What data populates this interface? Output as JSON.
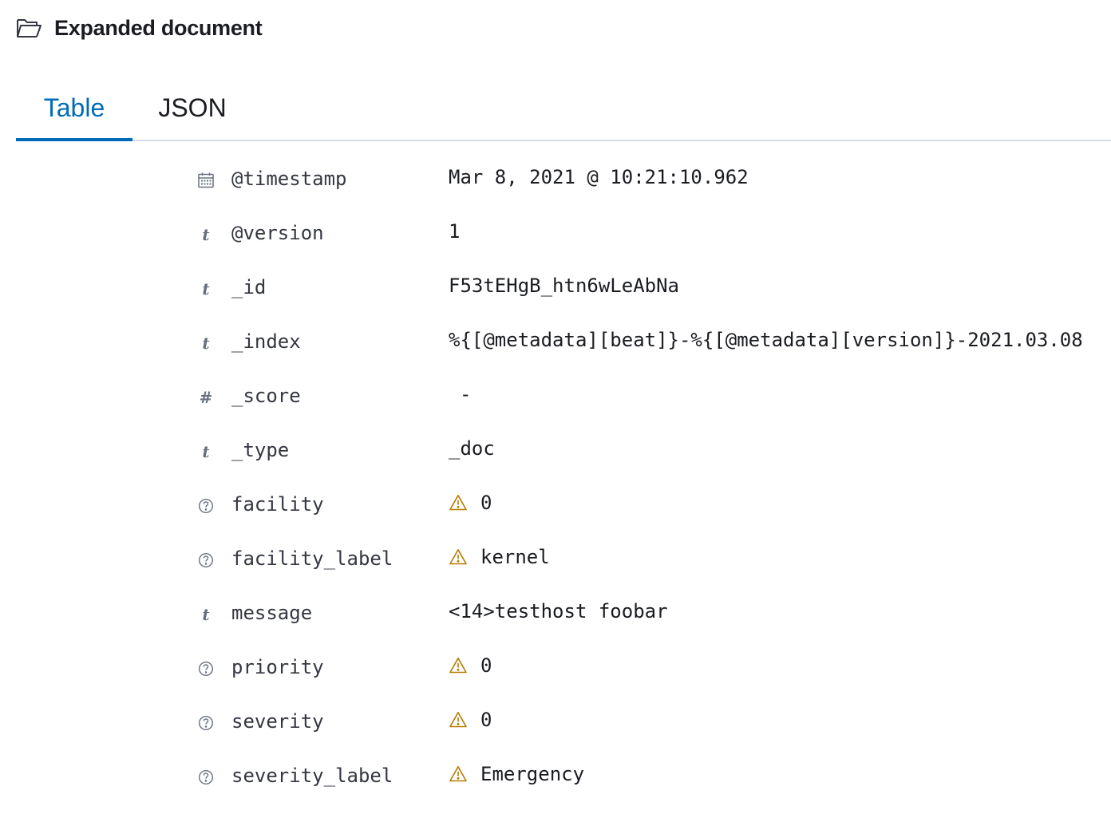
{
  "header": {
    "title": "Expanded document",
    "icon": "folder-open-icon"
  },
  "tabs": [
    {
      "label": "Table",
      "active": true
    },
    {
      "label": "JSON",
      "active": false
    }
  ],
  "colors": {
    "accent": "#006bb8",
    "warning": "#b57c00",
    "muted_icon": "#69707d",
    "divider": "#d3dae6"
  },
  "fields": [
    {
      "icon": "calendar-icon",
      "name": "@timestamp",
      "value": "Mar 8, 2021 @ 10:21:10.962",
      "warning": false
    },
    {
      "icon": "string-type-icon",
      "icon_glyph": "t",
      "name": "@version",
      "value": "1",
      "warning": false
    },
    {
      "icon": "string-type-icon",
      "icon_glyph": "t",
      "name": "_id",
      "value": "F53tEHgB_htn6wLeAbNa",
      "warning": false
    },
    {
      "icon": "string-type-icon",
      "icon_glyph": "t",
      "name": "_index",
      "value": "%{[@metadata][beat]}-%{[@metadata][version]}-2021.03.08",
      "warning": false
    },
    {
      "icon": "number-type-icon",
      "icon_glyph": "#",
      "name": "_score",
      "value": "-",
      "warning": false
    },
    {
      "icon": "string-type-icon",
      "icon_glyph": "t",
      "name": "_type",
      "value": "_doc",
      "warning": false
    },
    {
      "icon": "unknown-type-icon",
      "name": "facility",
      "value": "0",
      "warning": true
    },
    {
      "icon": "unknown-type-icon",
      "name": "facility_label",
      "value": "kernel",
      "warning": true
    },
    {
      "icon": "string-type-icon",
      "icon_glyph": "t",
      "name": "message",
      "value": "<14>testhost foobar",
      "warning": false
    },
    {
      "icon": "unknown-type-icon",
      "name": "priority",
      "value": "0",
      "warning": true
    },
    {
      "icon": "unknown-type-icon",
      "name": "severity",
      "value": "0",
      "warning": true
    },
    {
      "icon": "unknown-type-icon",
      "name": "severity_label",
      "value": "Emergency",
      "warning": true
    }
  ]
}
